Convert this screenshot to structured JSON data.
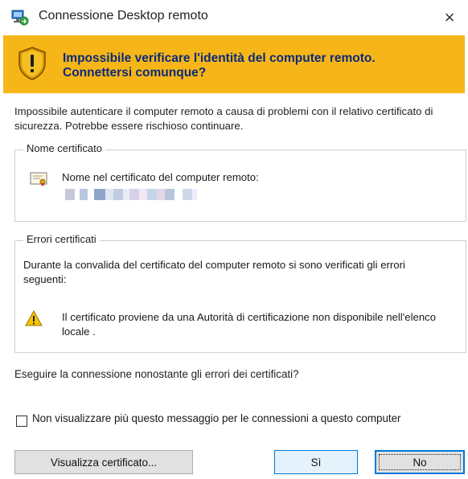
{
  "window": {
    "title": "Connessione Desktop remoto",
    "close_symbol": "×"
  },
  "banner": {
    "line1": "Impossibile verificare l'identità del computer remoto.",
    "line2": "Connettersi comunque?",
    "icon": "shield-warning-icon"
  },
  "body": {
    "text": "Impossibile autenticare il computer remoto a causa di problemi con il relativo certificato di sicurezza. Potrebbe essere rischioso continuare."
  },
  "cert_group": {
    "legend": "Nome certificato",
    "label": "Nome nel certificato del computer remoto:",
    "icon": "certificate-icon"
  },
  "errors_group": {
    "legend": "Errori certificati",
    "description": "Durante la convalida del certificato del computer remoto si sono verificati gli errori seguenti:",
    "error_text": "Il certificato proviene da una Autorità di certificazione non disponibile nell'elenco locale .",
    "icon": "warning-triangle-icon"
  },
  "question": "Eseguire la connessione nonostante gli errori dei certificati?",
  "checkbox": {
    "label": "Non visualizzare più questo messaggio per le connessioni a questo computer",
    "checked": false
  },
  "buttons": {
    "view_certificate": "Visualizza certificato...",
    "yes": "Sì",
    "no": "No"
  },
  "colors": {
    "banner": "#f7b618",
    "banner_text": "#0b2a7a",
    "accent": "#0078d7"
  }
}
